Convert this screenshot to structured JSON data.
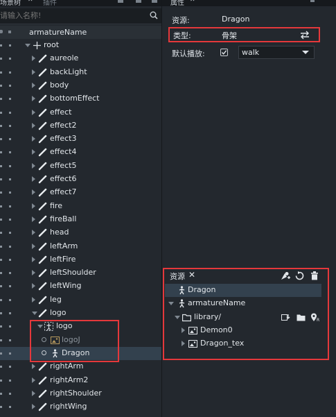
{
  "left_panel": {
    "tabs": [
      "场景树",
      "插件"
    ],
    "search_placeholder": "请输入名称!",
    "tree_header": "armatureName",
    "tree": [
      {
        "label": "root",
        "kind": "root"
      },
      {
        "label": "aureole"
      },
      {
        "label": "backLight"
      },
      {
        "label": "body"
      },
      {
        "label": "bottomEffect"
      },
      {
        "label": "effect"
      },
      {
        "label": "effect2"
      },
      {
        "label": "effect3"
      },
      {
        "label": "effect4"
      },
      {
        "label": "effect5"
      },
      {
        "label": "effect6"
      },
      {
        "label": "effect7"
      },
      {
        "label": "fire"
      },
      {
        "label": "fireBall"
      },
      {
        "label": "head"
      },
      {
        "label": "leftArm"
      },
      {
        "label": "leftFire"
      },
      {
        "label": "leftShoulder"
      },
      {
        "label": "leftWing"
      },
      {
        "label": "leg"
      },
      {
        "label": "logo",
        "expanded": true
      },
      {
        "label": "logo",
        "kind": "armature"
      },
      {
        "label": "logoJ",
        "kind": "image"
      },
      {
        "label": "Dragon",
        "kind": "dragon",
        "selected": true
      },
      {
        "label": "rightArm"
      },
      {
        "label": "rightArm2"
      },
      {
        "label": "rightShoulder"
      },
      {
        "label": "rightWing"
      }
    ]
  },
  "right_panel": {
    "tabs": [
      "属性"
    ],
    "properties": {
      "resource_label": "资源:",
      "resource_value": "Dragon",
      "type_label": "类型:",
      "type_value": "骨架",
      "default_play_label": "默认播放:",
      "default_play_checked": true,
      "default_play_value": "walk"
    }
  },
  "assets_panel": {
    "title": "资源",
    "items": [
      {
        "label": "Dragon",
        "kind": "dragon"
      },
      {
        "label": "armatureName",
        "kind": "dragon"
      },
      {
        "label": "library/",
        "kind": "folder"
      },
      {
        "label": "Demon0",
        "kind": "image"
      },
      {
        "label": "Dragon_tex",
        "kind": "image"
      }
    ]
  },
  "colors": {
    "highlight": "#e5383b",
    "selected_row": "#33414e",
    "panel_bg": "#23282e"
  }
}
